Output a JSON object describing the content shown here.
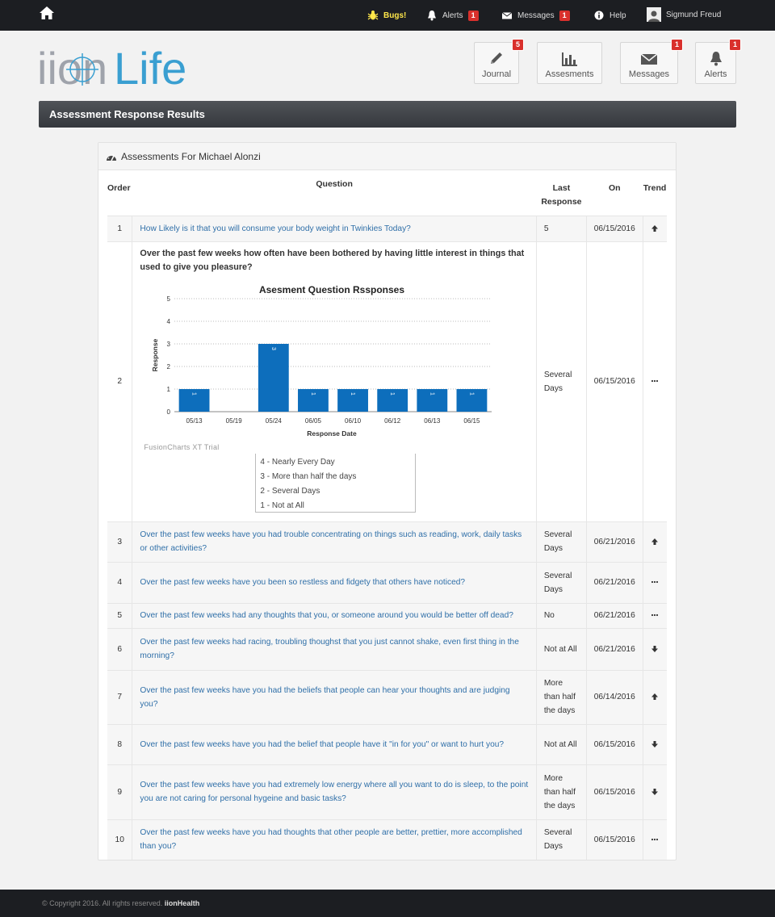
{
  "topnav": {
    "bugs": "Bugs!",
    "alerts": "Alerts",
    "alerts_count": "1",
    "messages": "Messages",
    "messages_count": "1",
    "help": "Help",
    "user": "Sigmund Freud"
  },
  "logo": {
    "part1": "iion",
    "part2": "Life"
  },
  "tiles": {
    "journal": "Journal",
    "journal_count": "5",
    "assessments": "Assesments",
    "messages": "Messages",
    "messages_count": "1",
    "alerts": "Alerts",
    "alerts_count": "1"
  },
  "page_title": "Assessment Response Results",
  "panel_title": "Assessments For Michael Alonzi",
  "table": {
    "headers": {
      "order": "Order",
      "question": "Question",
      "last": "Last Response",
      "on": "On",
      "trend": "Trend"
    },
    "rows": [
      {
        "order": "1",
        "question": "How Likely is it that you will consume your body weight in Twinkies Today?",
        "last": "5",
        "on": "06/15/2016",
        "trend": "up"
      },
      {
        "order": "2",
        "question": "Over the past few weeks how often have been bothered by having little interest in things that used to give you pleasure?",
        "last": "Several Days",
        "on": "06/15/2016",
        "trend": "same"
      },
      {
        "order": "3",
        "question": "Over the past few weeks have you had trouble concentrating on things such as reading, work, daily tasks or other activities?",
        "last": "Several Days",
        "on": "06/21/2016",
        "trend": "up"
      },
      {
        "order": "4",
        "question": "Over the past few weeks have you been so restless and fidgety that others have noticed?",
        "last": "Several Days",
        "on": "06/21/2016",
        "trend": "same"
      },
      {
        "order": "5",
        "question": "Over the past few weeks had any thoughts that you, or someone around you would be better off dead?",
        "last": "No",
        "on": "06/21/2016",
        "trend": "same"
      },
      {
        "order": "6",
        "question": "Over the past few weeks had racing, troubling thoughst that you just cannot shake, even first thing in the morning?",
        "last": "Not at All",
        "on": "06/21/2016",
        "trend": "down"
      },
      {
        "order": "7",
        "question": "Over the past few weeks have you had the beliefs that people can hear your thoughts and are judging you?",
        "last": "More than half the days",
        "on": "06/14/2016",
        "trend": "up"
      },
      {
        "order": "8",
        "question": "Over the past few weeks have you had the belief that people have it \"in for you\" or want to hurt you?",
        "last": "Not at All",
        "on": "06/15/2016",
        "trend": "down"
      },
      {
        "order": "9",
        "question": "Over the past few weeks have you had extremely low energy where all you want to do is sleep, to the point you are not caring for personal hygeine and basic tasks?",
        "last": "More than half the days",
        "on": "06/15/2016",
        "trend": "down"
      },
      {
        "order": "10",
        "question": "Over the past few weeks have you had thoughts that other people are better, prettier, more accomplished than you?",
        "last": "Several Days",
        "on": "06/15/2016",
        "trend": "same"
      }
    ]
  },
  "chart_data": {
    "type": "bar",
    "title": "Asesment Question Rssponses",
    "xlabel": "Response Date",
    "ylabel": "Response",
    "categories": [
      "05/13",
      "05/19",
      "05/24",
      "06/05",
      "06/10",
      "06/12",
      "06/13",
      "06/15"
    ],
    "values": [
      1,
      null,
      3,
      1,
      1,
      1,
      1,
      1
    ],
    "data_labels": [
      "1",
      "",
      "3",
      "1",
      "1",
      "1",
      "1",
      "1"
    ],
    "ylim": [
      0,
      5
    ],
    "yticks": [
      "0",
      "1",
      "2",
      "3",
      "4",
      "5"
    ],
    "grid": true,
    "bar_color": "#0d6ebc",
    "watermark": "FusionCharts XT Trial"
  },
  "legend": [
    "4 - Nearly Every Day",
    "3 - More than half the days",
    "2 - Several Days",
    "1 - Not at All"
  ],
  "footer": {
    "copyright": "© Copyright 2016. All rights reserved.",
    "brand": "iionHealth"
  },
  "colors": {
    "accent": "#3a9fd1",
    "badge": "#d9302c",
    "nav": "#1c1e22",
    "link": "#2f6fa8"
  }
}
